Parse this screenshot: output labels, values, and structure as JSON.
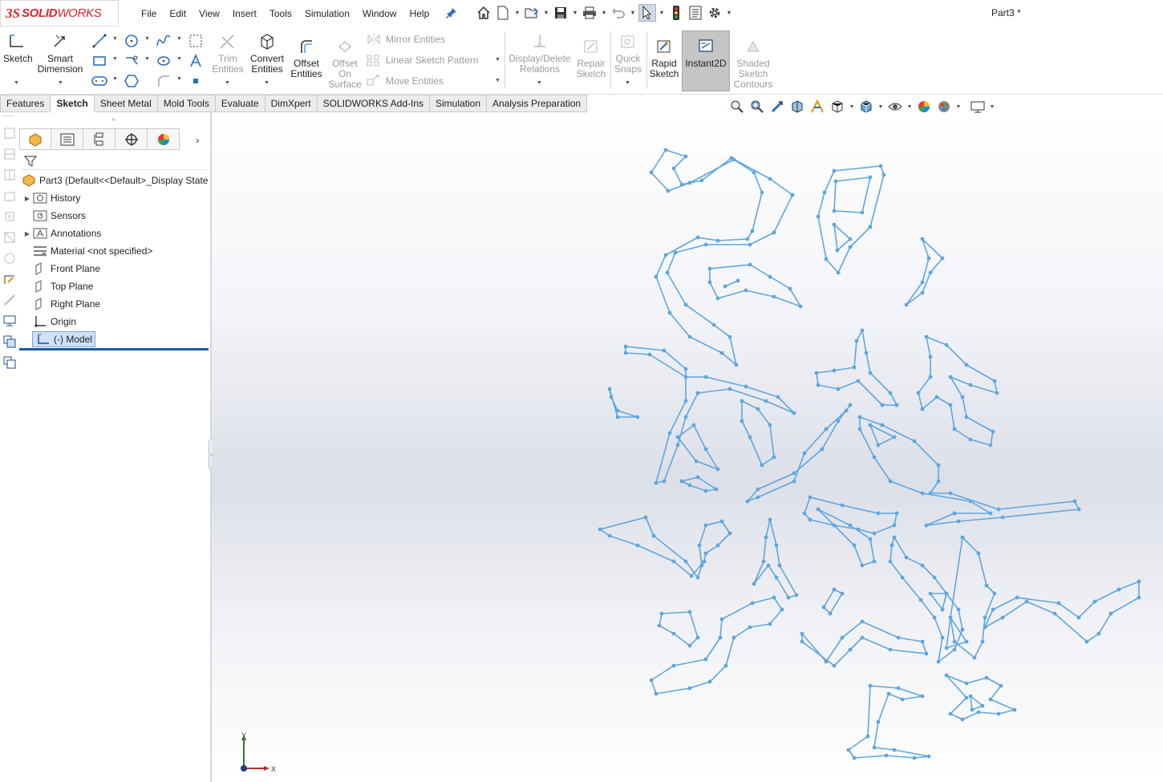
{
  "app": {
    "logo_ds": "3S",
    "logo_solid": "SOLID",
    "logo_works": "WORKS",
    "document_title": "Part3 *"
  },
  "menu": [
    "File",
    "Edit",
    "View",
    "Insert",
    "Tools",
    "Simulation",
    "Window",
    "Help"
  ],
  "ribbon": {
    "sketch": "Sketch",
    "smart_dimension": "Smart Dimension",
    "trim_entities": "Trim Entities",
    "convert_entities": "Convert Entities",
    "offset_entities": "Offset Entities",
    "offset_on_surface": "Offset On Surface",
    "mirror_entities": "Mirror Entities",
    "linear_sketch_pattern": "Linear Sketch Pattern",
    "move_entities": "Move Entities",
    "display_delete_relations": "Display/Delete Relations",
    "repair_sketch": "Repair Sketch",
    "quick_snaps": "Quick Snaps",
    "rapid_sketch": "Rapid Sketch",
    "instant2d": "Instant2D",
    "shaded_sketch_contours": "Shaded Sketch Contours"
  },
  "tabs": [
    "Features",
    "Sketch",
    "Sheet Metal",
    "Mold Tools",
    "Evaluate",
    "DimXpert",
    "SOLIDWORKS Add-Ins",
    "Simulation",
    "Analysis Preparation"
  ],
  "active_tab": "Sketch",
  "tree": {
    "root": "Part3  (Default<<Default>_Display State",
    "items": [
      "History",
      "Sensors",
      "Annotations",
      "Material <not specified>",
      "Front Plane",
      "Top Plane",
      "Right Plane",
      "Origin",
      "(-) Model"
    ]
  },
  "triad": {
    "y": "Y",
    "x": "X"
  },
  "colors": {
    "accent_red": "#d9262b",
    "sketch_blue": "#5fa6df",
    "selection_blue": "#cfe1f6"
  }
}
